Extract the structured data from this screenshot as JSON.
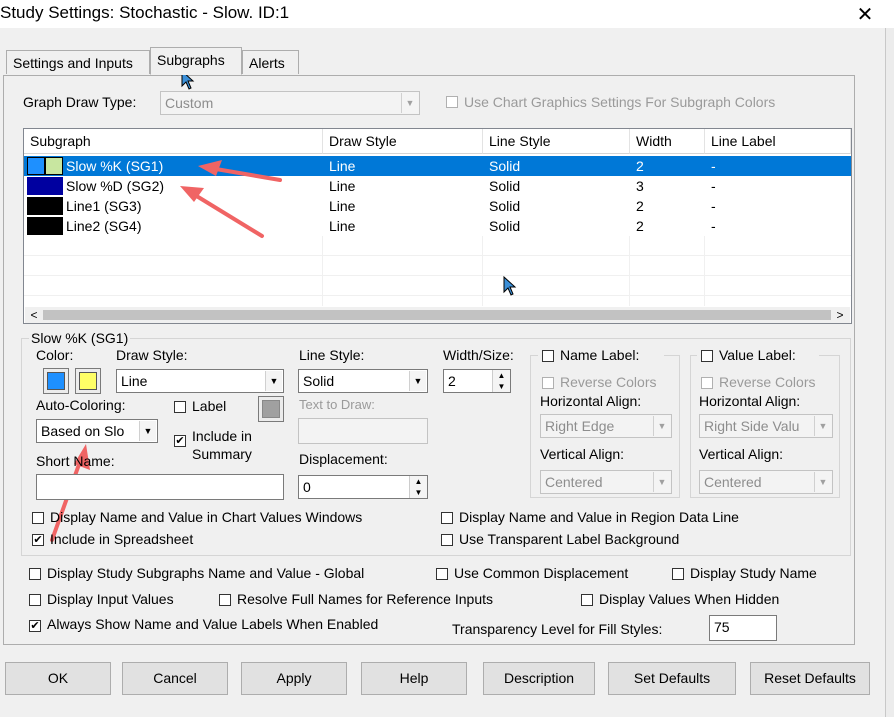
{
  "window": {
    "title": "Study Settings: Stochastic - Slow. ID:1",
    "close_glyph": "✕"
  },
  "tabs": [
    "Settings and Inputs",
    "Subgraphs",
    "Alerts"
  ],
  "graph_draw_type": {
    "label": "Graph Draw Type:",
    "value": "Custom",
    "use_chart_graphics_label": "Use Chart Graphics Settings For Subgraph Colors"
  },
  "grid": {
    "columns": [
      "Subgraph",
      "Draw Style",
      "Line Style",
      "Width",
      "Line Label"
    ],
    "rows": [
      {
        "name": "Slow %K (SG1)",
        "draw_style": "Line",
        "line_style": "Solid",
        "width": "2",
        "label": "-",
        "color1": "#1e90ff",
        "color2": "#c8e6a0"
      },
      {
        "name": "Slow %D (SG2)",
        "draw_style": "Line",
        "line_style": "Solid",
        "width": "3",
        "label": "-",
        "color1": "#0000a0",
        "color2": "#0000a0"
      },
      {
        "name": "Line1 (SG3)",
        "draw_style": "Line",
        "line_style": "Solid",
        "width": "2",
        "label": "-",
        "color1": "#000000",
        "color2": "#000000"
      },
      {
        "name": "Line2 (SG4)",
        "draw_style": "Line",
        "line_style": "Solid",
        "width": "2",
        "label": "-",
        "color1": "#000000",
        "color2": "#000000"
      }
    ]
  },
  "subgraph_group": {
    "title": "Slow %K (SG1)",
    "color_label": "Color:",
    "color1": "#1e90ff",
    "color2": "#ffff66",
    "draw_style_label": "Draw Style:",
    "draw_style_value": "Line",
    "line_style_label": "Line Style:",
    "line_style_value": "Solid",
    "width_label": "Width/Size:",
    "width_value": "2",
    "auto_coloring_label": "Auto-Coloring:",
    "auto_coloring_value": "Based on Slo",
    "label_checkbox": "Label",
    "text_to_draw_label": "Text to Draw:",
    "include_in_summary_label": "Include in Summary",
    "short_name_label": "Short Name:",
    "short_name_value": "",
    "displacement_label": "Displacement:",
    "displacement_value": "0",
    "name_label": {
      "title": "Name Label:",
      "reverse_colors": "Reverse Colors",
      "horizontal_align_label": "Horizontal Align:",
      "horizontal_align_value": "Right Edge",
      "vertical_align_label": "Vertical Align:",
      "vertical_align_value": "Centered"
    },
    "value_label": {
      "title": "Value Label:",
      "reverse_colors": "Reverse Colors",
      "horizontal_align_label": "Horizontal Align:",
      "horizontal_align_value": "Right Side Valu",
      "vertical_align_label": "Vertical Align:",
      "vertical_align_value": "Centered"
    },
    "display_name_value_chart": "Display Name and Value in Chart Values Windows",
    "display_name_value_region": "Display Name and Value in Region Data Line",
    "include_in_spreadsheet": "Include in Spreadsheet",
    "use_transparent_label_bg": "Use Transparent Label Background"
  },
  "global_options": {
    "display_study_subgraphs": "Display Study Subgraphs Name and Value - Global",
    "use_common_displacement": "Use Common Displacement",
    "display_study_name": "Display Study Name",
    "display_input_values": "Display Input Values",
    "resolve_full_names": "Resolve Full Names for Reference Inputs",
    "display_values_when_hidden": "Display Values When Hidden",
    "always_show_labels": "Always Show Name and Value Labels When Enabled",
    "transparency_label": "Transparency Level for Fill Styles:",
    "transparency_value": "75"
  },
  "buttons": {
    "ok": "OK",
    "cancel": "Cancel",
    "apply": "Apply",
    "help": "Help",
    "description": "Description",
    "set_defaults": "Set Defaults",
    "reset_defaults": "Reset Defaults"
  },
  "checkmark": "✔"
}
